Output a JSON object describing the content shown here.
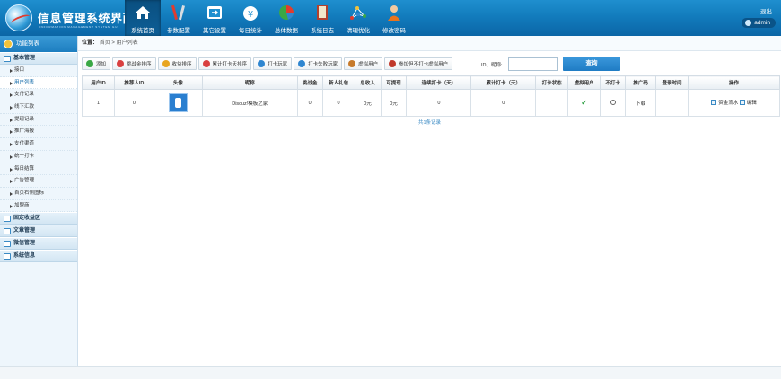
{
  "header": {
    "title": "信息管理系统界面",
    "subtitle": "INFORMATION MANAGEMENT SYSTEM GUI",
    "logout": "退出",
    "user": "admin"
  },
  "nav": [
    {
      "label": "系统首页",
      "icon": "home-icon"
    },
    {
      "label": "参数配置",
      "icon": "tools-icon"
    },
    {
      "label": "其它设置",
      "icon": "window-icon"
    },
    {
      "label": "每日统计",
      "icon": "money-bag-icon"
    },
    {
      "label": "总体数据",
      "icon": "pie-chart-icon"
    },
    {
      "label": "系统日志",
      "icon": "book-icon"
    },
    {
      "label": "清理优化",
      "icon": "graph-icon"
    },
    {
      "label": "修改密码",
      "icon": "person-icon"
    }
  ],
  "sidebar": {
    "title": "功能列表",
    "groups": [
      {
        "label": "基本管理",
        "items": [
          "接口",
          "用户列表",
          "支付记录",
          "线下汇款",
          "提现记录",
          "推广海报",
          "支付渠道",
          "统一打卡",
          "每日结算",
          "广告管理",
          "首页右侧图标",
          "加盟商"
        ]
      },
      {
        "label": "固定收益区"
      },
      {
        "label": "文章管理"
      },
      {
        "label": "微信管理"
      },
      {
        "label": "系统信息"
      }
    ]
  },
  "breadcrumb": {
    "prefix": "位置：",
    "home": "首页",
    "sep": ">",
    "current": "用户列表"
  },
  "toolbar": [
    {
      "label": "添加",
      "color": "#3aa845"
    },
    {
      "label": "挑战金排序",
      "color": "#d94040"
    },
    {
      "label": "收益排序",
      "color": "#e8a51f"
    },
    {
      "label": "累计打卡天排序",
      "color": "#d94040"
    },
    {
      "label": "打卡玩家",
      "color": "#2f86d0"
    },
    {
      "label": "打卡失败玩家",
      "color": "#2f86d0"
    },
    {
      "label": "虚拟用户",
      "color": "#c77a2b"
    },
    {
      "label": "参加但不打卡虚拟用户",
      "color": "#c0392b"
    }
  ],
  "search": {
    "label": "ID、昵称:",
    "value": "",
    "button": "查询"
  },
  "table": {
    "columns": [
      "用户ID",
      "推荐人ID",
      "头像",
      "昵称",
      "挑战金",
      "新人礼包",
      "总收入",
      "可提现",
      "连续打卡（天）",
      "累计打卡（天）",
      "打卡状态",
      "虚拟用户",
      "不打卡",
      "推广码",
      "登录时间",
      "操作"
    ],
    "rows": [
      {
        "id": "1",
        "ref": "0",
        "nick": "Discuz!模板之家",
        "fund": "0",
        "gift": "0",
        "income": "0元",
        "withdraw": "0元",
        "streak": "0",
        "total": "0",
        "status": "",
        "virtual": "✔",
        "noclock": "",
        "promo": "下载",
        "login": "",
        "op1": "资金流水",
        "op2": "编辑"
      }
    ],
    "summary": "共1条记录"
  }
}
